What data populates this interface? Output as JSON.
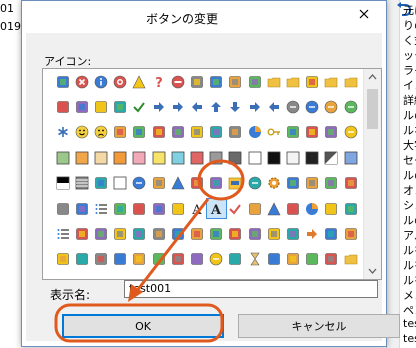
{
  "background": {
    "left_texts": [
      "01",
      "019_"
    ],
    "right_texts": [
      "元に",
      "りの",
      "く式",
      "ックス",
      "ライ",
      "イン",
      "詳細",
      "ルの",
      "ルな",
      "大字",
      "セー",
      "ルの",
      "オン",
      "シン",
      "ルの",
      "アル",
      "ルを",
      "ルを",
      "ルを",
      "メン",
      "ペン",
      "test",
      "test"
    ]
  },
  "dialog": {
    "title": "ボタンの変更",
    "icon_label": "アイコン:",
    "name_label": "表示名:",
    "name_value": "test001",
    "ok_label": "OK",
    "cancel_label": "キャンセル"
  },
  "accent": "#e05a1e",
  "icon_grid": {
    "selected_row": 5,
    "selected_col": 8,
    "rows": [
      [
        "tree",
        "x-circle",
        "info-circle",
        "target",
        "warning",
        "help",
        "no-entry",
        "shield",
        "shield-color",
        "doc-edit",
        "floppy-stack",
        "folder-open",
        "folder",
        "notes-folder",
        "folder-group",
        "folder-plain"
      ],
      [
        "print-folder",
        "chart-image",
        "chart-doc",
        "chart-doc2",
        "check",
        "arrows-lr",
        "arrows-lr2",
        "arrow-left",
        "arrow-up",
        "arrow-down",
        "arrow-right",
        "arrow-left2",
        "arrow-circle-left",
        "arrow-circle-right",
        "arrow-circle-up",
        "arrow-circle-down"
      ],
      [
        "asterisk",
        "smile",
        "sad",
        "square-gray",
        "magnifier",
        "funnel",
        "crop",
        "balance",
        "document-color",
        "palette",
        "pie",
        "key",
        "person",
        "people",
        "table",
        "globe"
      ],
      [
        "sq-green",
        "sq-orange",
        "sq-beige",
        "sq-orange2",
        "sq-pink",
        "sq-yellow",
        "sq-cyan",
        "sq-red",
        "sq-gray",
        "sq-gray2",
        "sq-white",
        "sq-black",
        "sq-white2",
        "sq-black2",
        "sq-half",
        "sq-blue"
      ],
      [
        "sq-black-white",
        "sq-stripe",
        "grid-bw",
        "sq-white-b",
        "arrow-circle",
        "water-drop",
        "triangle-blue",
        "mountain",
        "dark-blue",
        "yellow-folder",
        "circle-orange",
        "gear",
        "wand",
        "book-stack",
        "books",
        "box"
      ],
      [
        "table-blue",
        "pen-blue",
        "list",
        "people-doc",
        "anchor",
        "stars",
        "hook",
        "font-a",
        "font-a-bold",
        "check-red",
        "pencil-doc",
        "triangle-doc",
        "hand",
        "pie-color",
        "mail",
        "ruler"
      ],
      [
        "bullet-list",
        "calendar",
        "orange-sq",
        "red-cube",
        "cubes",
        "box-red",
        "tools",
        "faces",
        "color-sq",
        "cards",
        "notes",
        "doc-blue",
        "pencil-yellow",
        "arrow-curve",
        "chart-bar",
        "link"
      ],
      [
        "clipboard",
        "tag-blue",
        "doc-red",
        "gift",
        "table-red",
        "flag",
        "spell",
        "doc-table",
        "doc-circle",
        "shield-blue",
        "hourglass",
        "pencil-red",
        "doc-multi",
        "grid-color",
        "people-row",
        "folder-yellow"
      ]
    ]
  }
}
